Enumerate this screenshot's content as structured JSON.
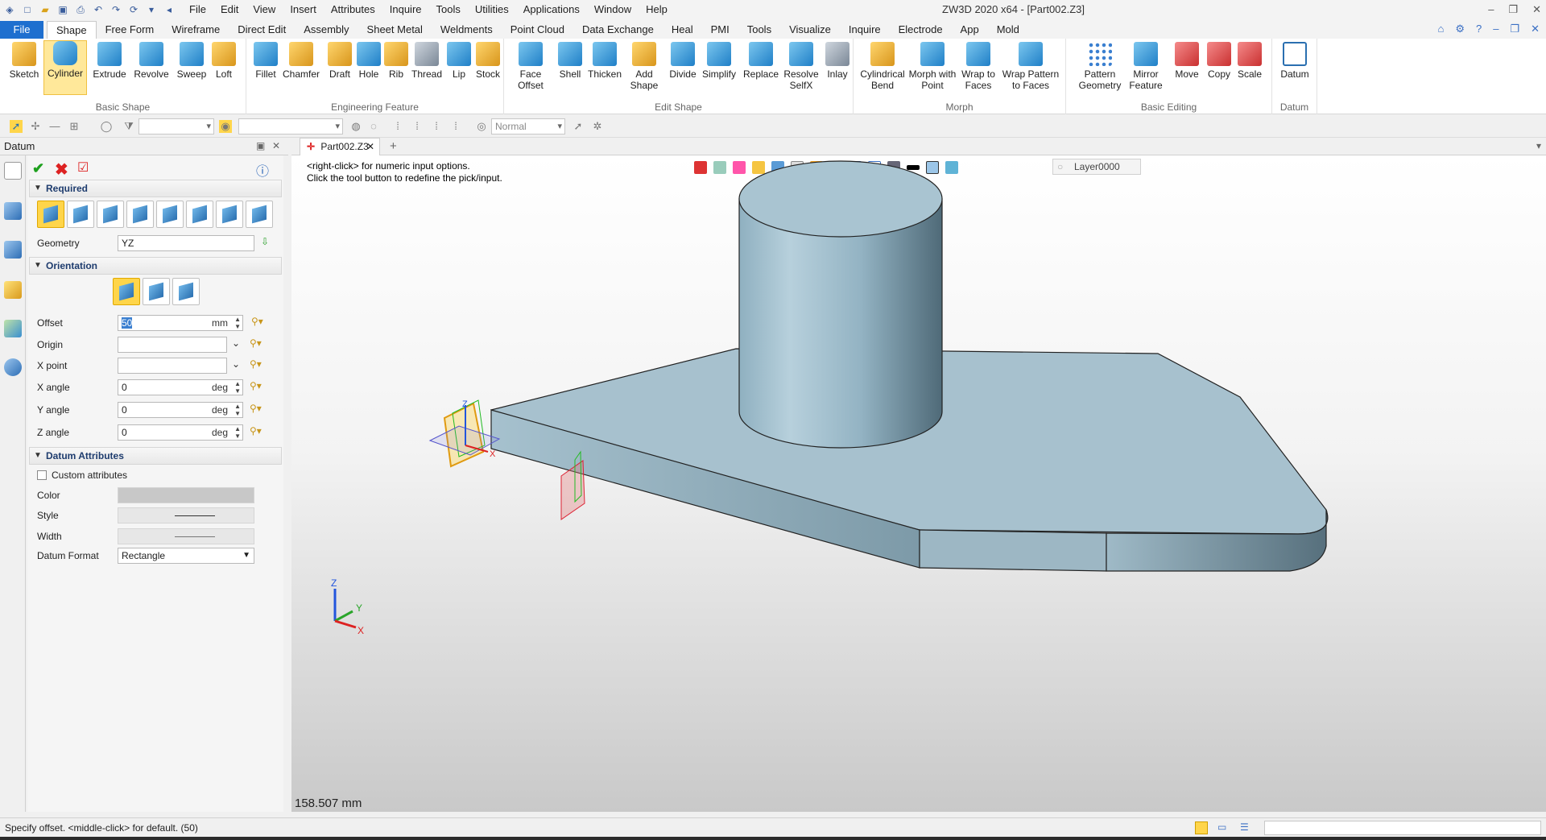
{
  "titlebar": {
    "app_title": "ZW3D 2020 x64 - [Part002.Z3]",
    "menu": [
      "File",
      "Edit",
      "View",
      "Insert",
      "Attributes",
      "Inquire",
      "Tools",
      "Utilities",
      "Applications",
      "Window",
      "Help"
    ]
  },
  "ribbon_tabs": [
    "File",
    "Shape",
    "Free Form",
    "Wireframe",
    "Direct Edit",
    "Assembly",
    "Sheet Metal",
    "Weldments",
    "Point Cloud",
    "Data Exchange",
    "Heal",
    "PMI",
    "Tools",
    "Visualize",
    "Inquire",
    "Electrode",
    "App",
    "Mold"
  ],
  "ribbon": {
    "groups": [
      {
        "label": "Basic Shape",
        "buttons": [
          "Sketch",
          "Cylinder",
          "Extrude",
          "Revolve",
          "Sweep",
          "Loft"
        ]
      },
      {
        "label": "Engineering Feature",
        "buttons": [
          "Fillet",
          "Chamfer",
          "Draft",
          "Hole",
          "Rib",
          "Thread",
          "Lip",
          "Stock"
        ]
      },
      {
        "label": "Edit Shape",
        "buttons": [
          "Face Offset",
          "Shell",
          "Thicken",
          "Add Shape",
          "Divide",
          "Simplify",
          "Replace",
          "Resolve SelfX",
          "Inlay"
        ]
      },
      {
        "label": "Morph",
        "buttons": [
          "Cylindrical Bend",
          "Morph with Point",
          "Wrap to Faces",
          "Wrap Pattern to Faces"
        ]
      },
      {
        "label": "Basic Editing",
        "buttons": [
          "Pattern Geometry",
          "Mirror Feature",
          "Move",
          "Copy",
          "Scale"
        ]
      },
      {
        "label": "Datum",
        "buttons": [
          "Datum"
        ]
      }
    ]
  },
  "toolbar2": {
    "mode_combo": "Normal"
  },
  "panel": {
    "title": "Datum",
    "sections": {
      "required": "Required",
      "orientation": "Orientation",
      "datum_attributes": "Datum Attributes"
    },
    "geometry": {
      "label": "Geometry",
      "value": "YZ"
    },
    "offset": {
      "label": "Offset",
      "value": "50",
      "unit": "mm"
    },
    "origin": {
      "label": "Origin",
      "value": ""
    },
    "xpoint": {
      "label": "X point",
      "value": ""
    },
    "xangle": {
      "label": "X angle",
      "value": "0",
      "unit": "deg"
    },
    "yangle": {
      "label": "Y angle",
      "value": "0",
      "unit": "deg"
    },
    "zangle": {
      "label": "Z angle",
      "value": "0",
      "unit": "deg"
    },
    "custom_attributes": {
      "label": "Custom attributes",
      "checked": false
    },
    "color": {
      "label": "Color"
    },
    "style": {
      "label": "Style"
    },
    "width": {
      "label": "Width"
    },
    "datum_format": {
      "label": "Datum Format",
      "value": "Rectangle"
    }
  },
  "document": {
    "tab": "Part002.Z3"
  },
  "viewport": {
    "prompt_line1": "<right-click> for numeric input options.",
    "prompt_line2": "Click the tool button to redefine the pick/input.",
    "layer": "Layer0000",
    "measure": "158.507 mm",
    "axis_labels": {
      "x": "X",
      "y": "Y",
      "z": "Z"
    }
  },
  "status": {
    "message": "Specify offset.  <middle-click> for default. (50)"
  },
  "colors": {
    "accent": "#1e6fcf",
    "part_face": "#a9c4d1",
    "selection": "#ffd54a"
  }
}
